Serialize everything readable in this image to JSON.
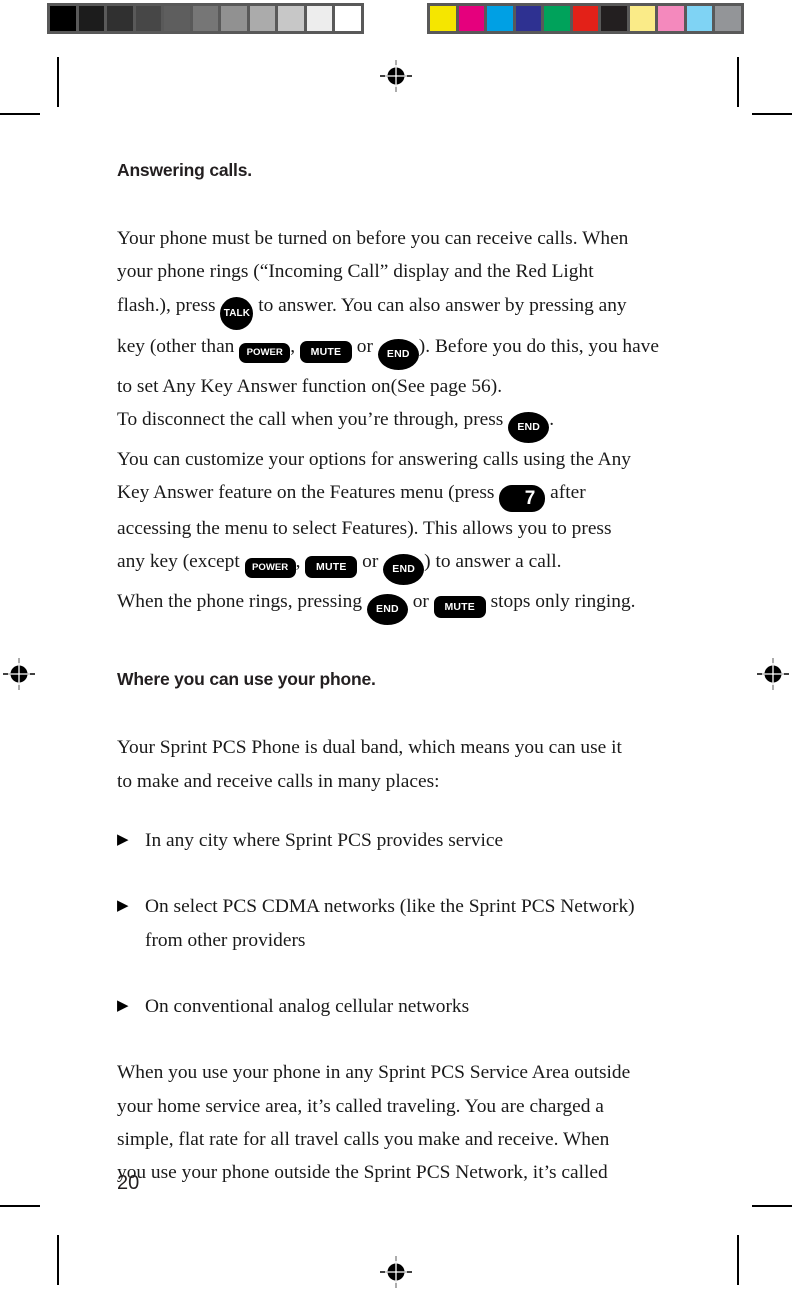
{
  "page": {
    "folio": "20"
  },
  "calibration": {
    "grayscale_label": "grayscale-step-wedge",
    "grayscale_swatches": [
      "#000000",
      "#1c1c1c",
      "#303030",
      "#474747",
      "#5e5e5e",
      "#767676",
      "#919191",
      "#ababab",
      "#c7c7c7",
      "#ededed",
      "#ffffff"
    ],
    "color_label": "color-control-bar",
    "color_swatches": [
      "#f5e600",
      "#e5007d",
      "#00a0e4",
      "#2e3191",
      "#00a25b",
      "#e32118",
      "#231f20",
      "#faeb88",
      "#f489bd",
      "#7fd3f4",
      "#939598"
    ]
  },
  "section1": {
    "heading": "Answering calls.",
    "lines": [
      {
        "id": "l1",
        "segments": [
          {
            "type": "text",
            "value": "Your phone must be turned on before you can receive calls. When"
          }
        ]
      },
      {
        "id": "l2",
        "segments": [
          {
            "type": "text",
            "value": "your phone rings (“Incoming Call” display and the Red Light"
          }
        ]
      },
      {
        "id": "l3",
        "segments": [
          {
            "type": "text",
            "value": "flash.), press "
          },
          {
            "type": "key",
            "style": "talk",
            "value": "TALK"
          },
          {
            "type": "text",
            "value": " to answer. You can also answer by pressing any"
          }
        ]
      },
      {
        "id": "l4",
        "segments": [
          {
            "type": "text",
            "value": "key (other than "
          },
          {
            "type": "key",
            "style": "power",
            "value": "POWER"
          },
          {
            "type": "text",
            "value": ", "
          },
          {
            "type": "key",
            "style": "mute",
            "value": "MUTE"
          },
          {
            "type": "text",
            "value": " or "
          },
          {
            "type": "key",
            "style": "end",
            "value": "END"
          },
          {
            "type": "text",
            "value": "). Before you do this, you have"
          }
        ]
      },
      {
        "id": "l5",
        "segments": [
          {
            "type": "text",
            "value": "to set Any Key Answer function on(See page 56)."
          }
        ]
      },
      {
        "id": "l6",
        "segments": [
          {
            "type": "text",
            "value": "To disconnect the call when you’re through, press "
          },
          {
            "type": "key",
            "style": "end",
            "value": "END"
          },
          {
            "type": "text",
            "value": "."
          }
        ]
      },
      {
        "id": "l7",
        "segments": [
          {
            "type": "text",
            "value": "You can customize your options for answering calls using the Any"
          }
        ]
      },
      {
        "id": "l8",
        "segments": [
          {
            "type": "text",
            "value": "Key Answer feature on the Features menu (press "
          },
          {
            "type": "key",
            "style": "seven",
            "value": "7"
          },
          {
            "type": "text",
            "value": " after"
          }
        ]
      },
      {
        "id": "l9",
        "segments": [
          {
            "type": "text",
            "value": "accessing the menu to select Features). This allows you to press"
          }
        ]
      },
      {
        "id": "l10",
        "segments": [
          {
            "type": "text",
            "value": "any key (except "
          },
          {
            "type": "key",
            "style": "power",
            "value": "POWER"
          },
          {
            "type": "text",
            "value": ", "
          },
          {
            "type": "key",
            "style": "mute",
            "value": "MUTE"
          },
          {
            "type": "text",
            "value": " or "
          },
          {
            "type": "key",
            "style": "end",
            "value": "END"
          },
          {
            "type": "text",
            "value": ") to answer a call."
          }
        ]
      },
      {
        "id": "l11",
        "segments": [
          {
            "type": "text",
            "value": "When the phone rings, pressing "
          },
          {
            "type": "key",
            "style": "end",
            "value": "END"
          },
          {
            "type": "text",
            "value": " or "
          },
          {
            "type": "key",
            "style": "mute",
            "value": "MUTE"
          },
          {
            "type": "text",
            "value": " stops only ringing."
          }
        ]
      }
    ]
  },
  "section2": {
    "heading": "Where you can use your phone.",
    "intro": [
      "Your Sprint PCS Phone is dual band, which means you can use it",
      "to make and receive calls in many places:"
    ],
    "bullet_marker": "▶",
    "bullets": [
      {
        "lines": [
          "In any city where Sprint PCS provides service"
        ]
      },
      {
        "lines": [
          "On select PCS CDMA networks (like the Sprint PCS Network)",
          "from other providers"
        ]
      },
      {
        "lines": [
          "On conventional analog cellular networks"
        ]
      }
    ],
    "closing": [
      "When you use your phone in any Sprint PCS Service Area outside",
      "your home service area, it’s called traveling. You are charged a",
      "simple, flat rate for all travel calls you make and receive. When",
      "you use your phone outside the Sprint PCS Network, it’s called"
    ]
  }
}
